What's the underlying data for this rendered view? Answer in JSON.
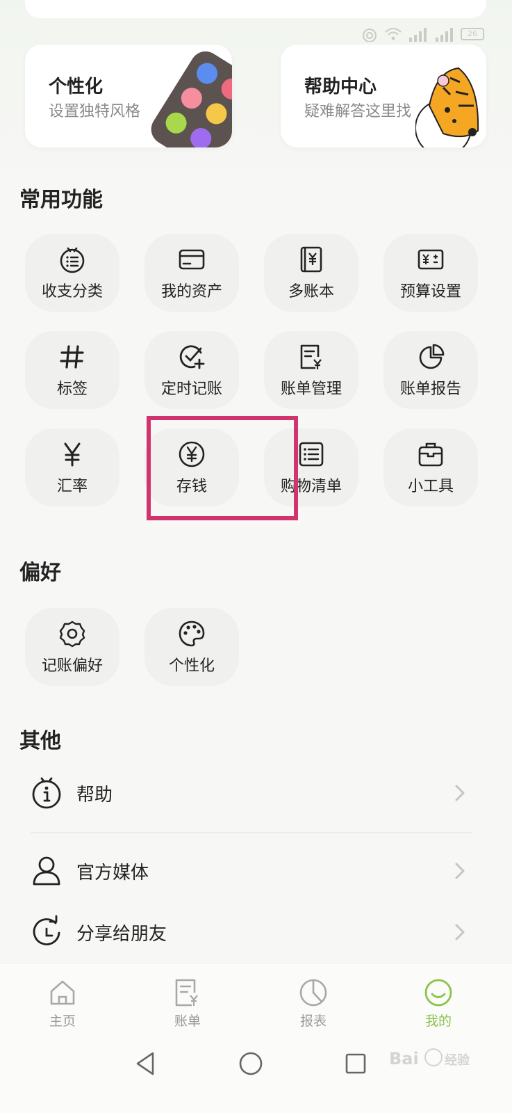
{
  "status_bar": {
    "battery": "26"
  },
  "feature_cards": {
    "personalize": {
      "title": "个性化",
      "subtitle": "设置独特风格"
    },
    "help_center": {
      "title": "帮助中心",
      "subtitle": "疑难解答这里找"
    }
  },
  "sections": {
    "common": "常用功能",
    "preferences": "偏好",
    "other": "其他"
  },
  "common_functions": [
    {
      "label": "收支分类",
      "icon": "category-icon"
    },
    {
      "label": "我的资产",
      "icon": "wallet-card-icon"
    },
    {
      "label": "多账本",
      "icon": "ledger-book-icon"
    },
    {
      "label": "预算设置",
      "icon": "budget-icon"
    },
    {
      "label": "标签",
      "icon": "hashtag-icon"
    },
    {
      "label": "定时记账",
      "icon": "scheduled-check-icon"
    },
    {
      "label": "账单管理",
      "icon": "bill-manage-icon"
    },
    {
      "label": "账单报告",
      "icon": "pie-report-icon"
    },
    {
      "label": "汇率",
      "icon": "yen-icon"
    },
    {
      "label": "存钱",
      "icon": "yen-circle-icon"
    },
    {
      "label": "购物清单",
      "icon": "shopping-list-icon"
    },
    {
      "label": "小工具",
      "icon": "toolbox-icon"
    }
  ],
  "preferences": [
    {
      "label": "记账偏好",
      "icon": "gear-icon"
    },
    {
      "label": "个性化",
      "icon": "palette-icon"
    }
  ],
  "other_items": [
    {
      "label": "帮助",
      "icon": "info-icon"
    },
    {
      "label": "官方媒体",
      "icon": "person-icon"
    },
    {
      "label": "分享给朋友",
      "icon": "share-refresh-icon"
    }
  ],
  "tabbar": [
    {
      "label": "主页",
      "icon": "home-icon"
    },
    {
      "label": "账单",
      "icon": "bill-icon"
    },
    {
      "label": "报表",
      "icon": "report-pie-icon"
    },
    {
      "label": "我的",
      "icon": "smile-icon",
      "active": true
    }
  ],
  "colors": {
    "accent": "#8bc34a",
    "highlight": "#d1336e",
    "tile_bg": "#f0f0ee"
  }
}
